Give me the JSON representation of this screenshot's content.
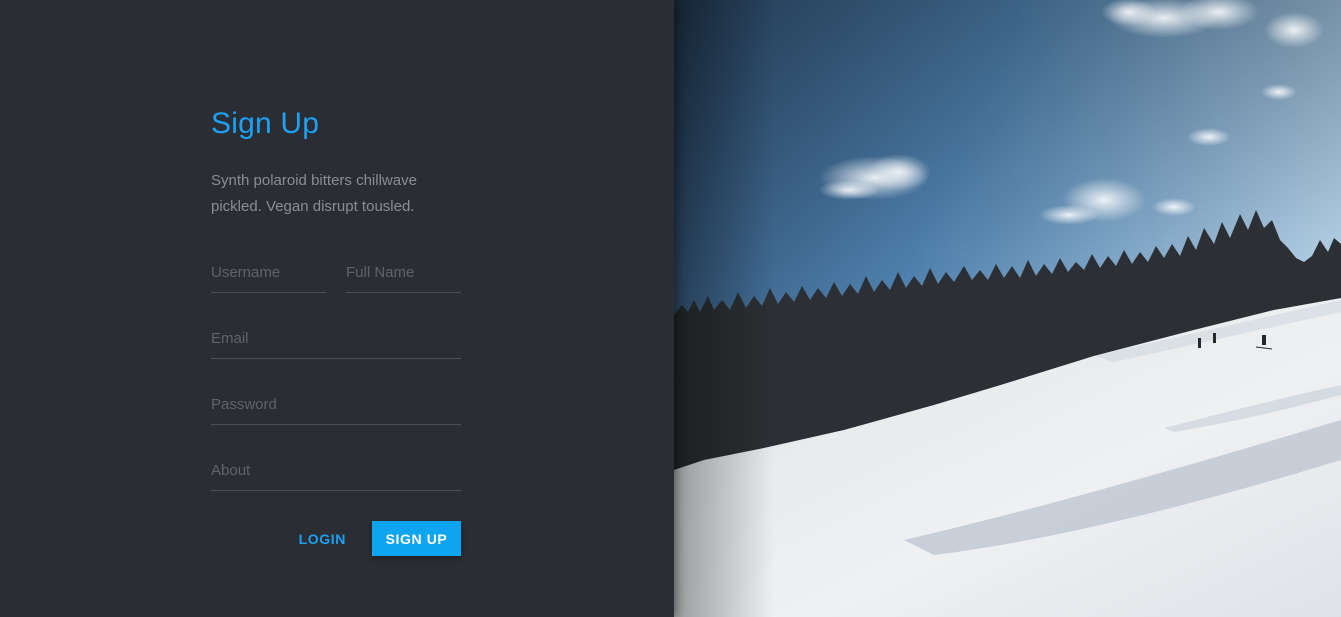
{
  "signup": {
    "title": "Sign Up",
    "description": "Synth polaroid bitters chillwave pickled. Vegan disrupt tousled.",
    "fields": {
      "username_placeholder": "Username",
      "fullname_placeholder": "Full Name",
      "email_placeholder": "Email",
      "password_placeholder": "Password",
      "about_placeholder": "About"
    },
    "login_label": "LOGIN",
    "signup_label": "SIGN UP"
  },
  "colors": {
    "panel_background": "#2a2d33",
    "accent": "#1da1f2",
    "button": "#0ea5f0"
  },
  "hero_image": {
    "subject": "snowy-ski-slope-with-pine-forest-and-blue-sky"
  }
}
